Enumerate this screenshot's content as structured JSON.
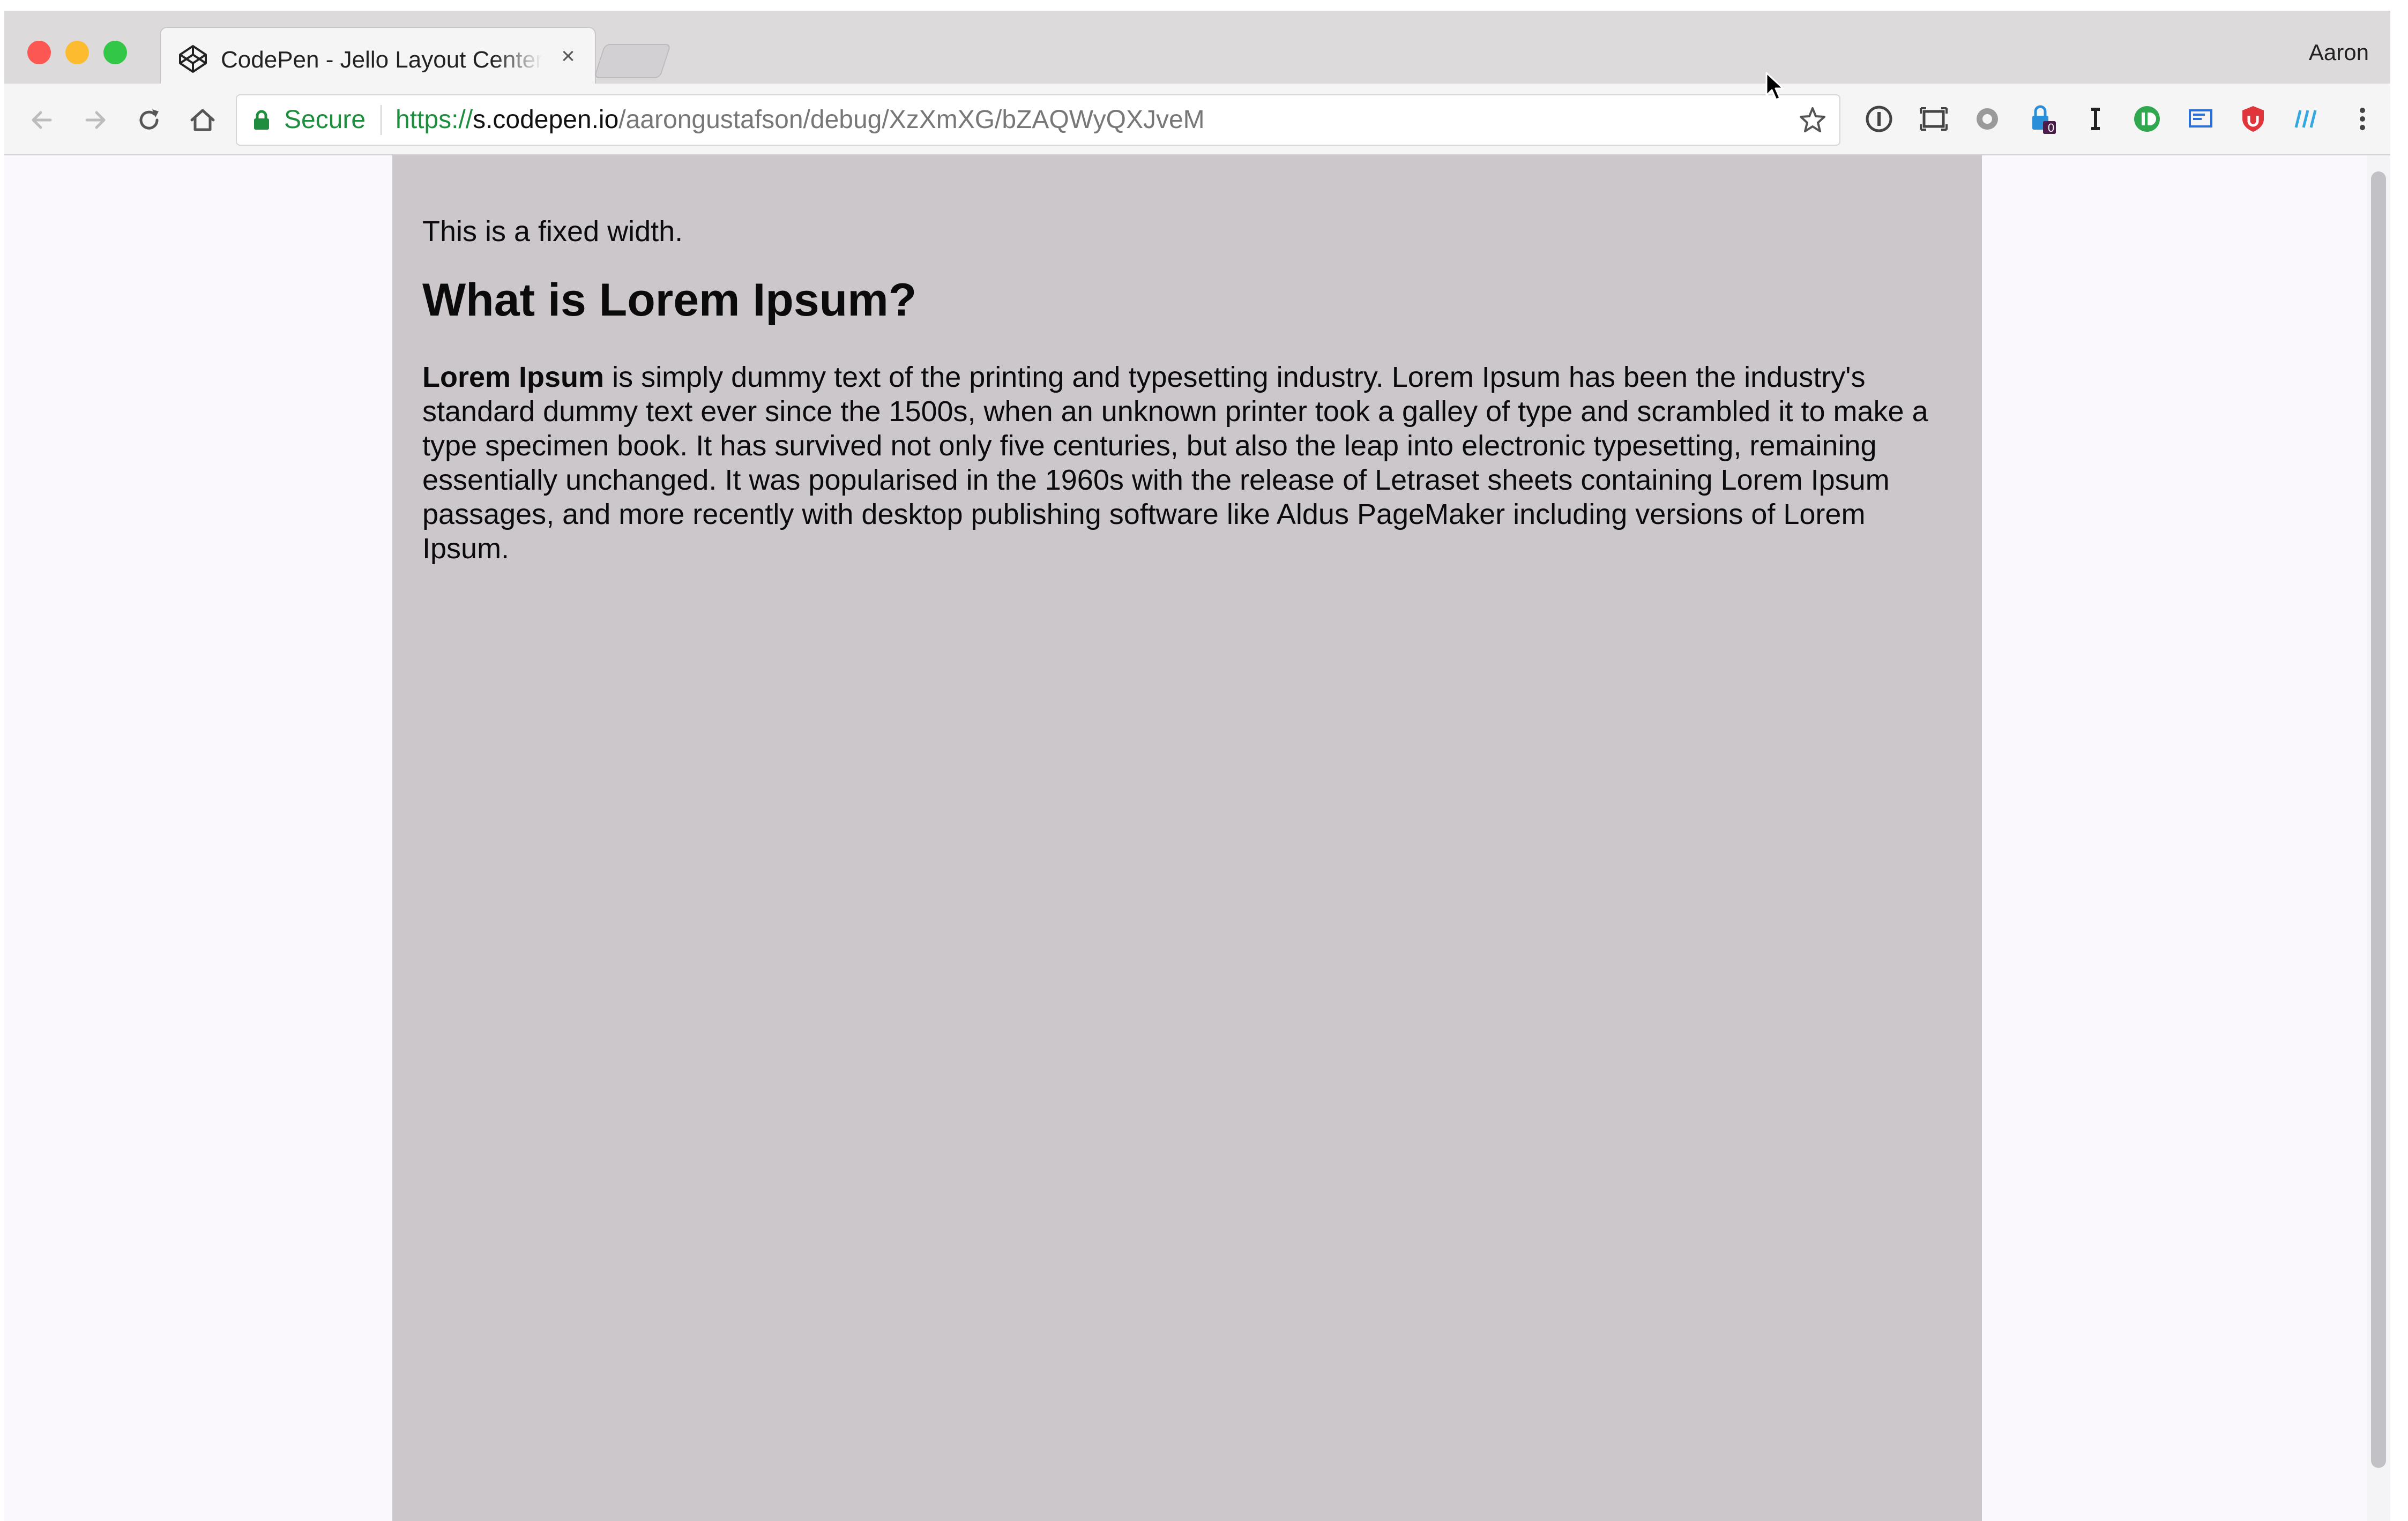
{
  "browser": {
    "tab": {
      "title": "CodePen - Jello Layout Center",
      "close_glyph": "×",
      "icon": "codepen-logo-icon"
    },
    "profile_name": "Aaron",
    "nav_icons": [
      "back-arrow-icon",
      "forward-arrow-icon",
      "reload-icon",
      "home-icon"
    ],
    "address_bar": {
      "secure_label": "Secure",
      "url_scheme": "https://",
      "url_host": "s.codepen.io",
      "url_path": "/aarongustafson/debug/XzXmXG/bZAQWyQXJveM",
      "bookmark_icon": "star-icon"
    },
    "extensions": [
      {
        "name": "onepassword-icon"
      },
      {
        "name": "screenshot-icon"
      },
      {
        "name": "settings-extension-icon"
      },
      {
        "name": "lastpass-icon",
        "badge": "0"
      },
      {
        "name": "instapaper-icon"
      },
      {
        "name": "pushbullet-icon"
      },
      {
        "name": "cast-icon"
      },
      {
        "name": "ublock-icon"
      },
      {
        "name": "readability-icon"
      },
      {
        "name": "more-menu-icon"
      }
    ]
  },
  "page": {
    "fixed_note": "This is a fixed width.",
    "heading": "What is Lorem Ipsum?",
    "paragraph_lead": "Lorem Ipsum",
    "paragraph_body": " is simply dummy text of the printing and typesetting industry. Lorem Ipsum has been the industry's standard dummy text ever since the 1500s, when an unknown printer took a galley of type and scrambled it to make a type specimen book. It has survived not only five centuries, but also the leap into electronic typesetting, remaining essentially unchanged. It was popularised in the 1960s with the release of Letraset sheets containing Lorem Ipsum passages, and more recently with desktop publishing software like Aldus PageMaker including versions of Lorem Ipsum."
  },
  "colors": {
    "secure_green": "#1e8e3e",
    "content_background": "#cbc7cb",
    "page_background": "#faf8fd"
  }
}
